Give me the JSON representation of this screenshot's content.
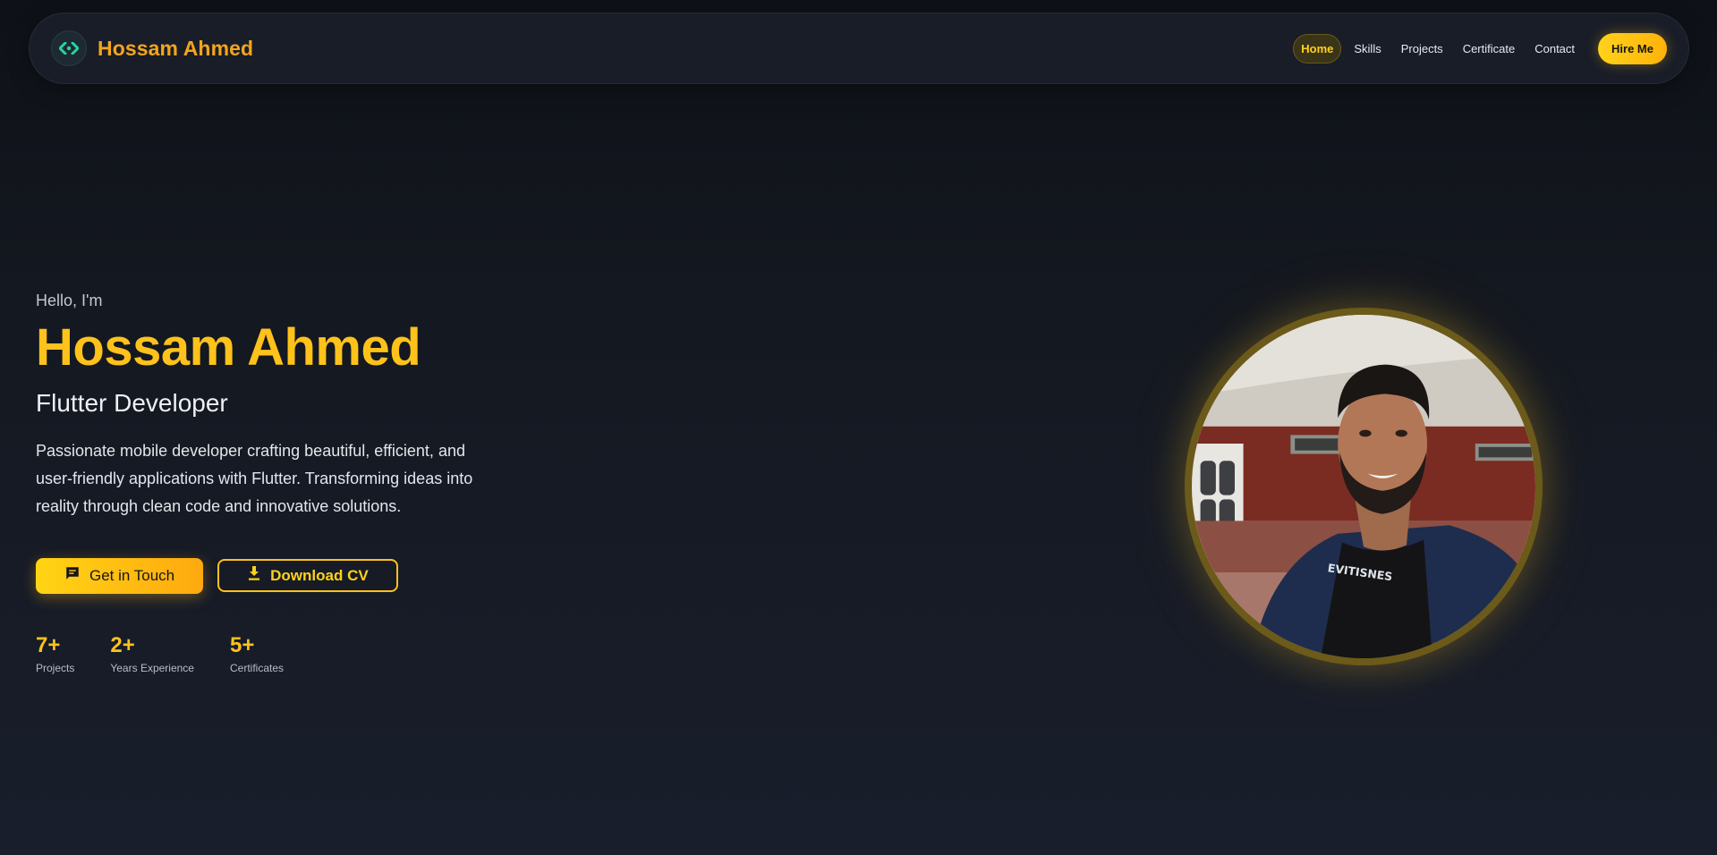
{
  "nav": {
    "brand": "Hossam Ahmed",
    "links": [
      "Home",
      "Skills",
      "Projects",
      "Certificate",
      "Contact"
    ],
    "active": "Home",
    "hire_label": "Hire Me"
  },
  "hero": {
    "greeting": "Hello, I'm",
    "name": "Hossam Ahmed",
    "role": "Flutter Developer",
    "description": "Passionate mobile developer crafting beautiful, efficient, and user-friendly applications with Flutter. Transforming ideas into reality through clean code and innovative solutions.",
    "primary_cta": "Get in Touch",
    "secondary_cta": "Download CV",
    "stats": [
      {
        "value": "7+",
        "label": "Projects"
      },
      {
        "value": "2+",
        "label": "Years Experience"
      },
      {
        "value": "5+",
        "label": "Certificates"
      }
    ]
  },
  "colors": {
    "accent": "#ffc21a",
    "brand_text": "#f4a51c",
    "logo_icon": "#25d3a0",
    "background": "#141820"
  },
  "icons": {
    "logo": "code-icon",
    "primary_cta": "chat-icon",
    "secondary_cta": "download-icon"
  }
}
